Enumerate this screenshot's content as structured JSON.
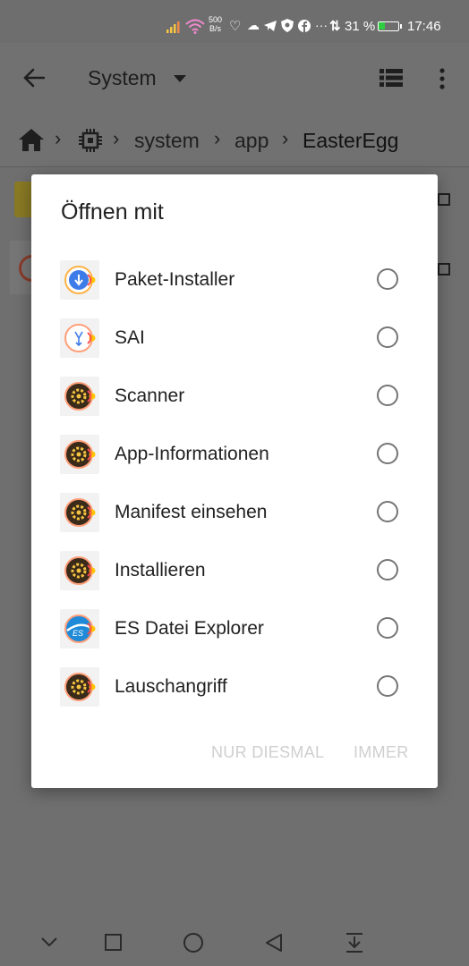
{
  "status_bar": {
    "net_speed_value": "500",
    "net_speed_unit": "B/s",
    "battery": "31 %",
    "time": "17:46"
  },
  "app_bar": {
    "title": "System"
  },
  "breadcrumb": {
    "items": [
      "system",
      "app",
      "EasterEgg"
    ]
  },
  "dialog": {
    "title": "Öffnen mit",
    "options": [
      {
        "label": "Paket-Installer",
        "icon": "package-installer-icon"
      },
      {
        "label": "SAI",
        "icon": "sai-icon"
      },
      {
        "label": "Scanner",
        "icon": "gear-app-icon"
      },
      {
        "label": "App-Informationen",
        "icon": "gear-app-icon"
      },
      {
        "label": "Manifest einsehen",
        "icon": "gear-app-icon"
      },
      {
        "label": "Installieren",
        "icon": "gear-app-icon"
      },
      {
        "label": "ES Datei Explorer",
        "icon": "es-explorer-icon"
      },
      {
        "label": "Lauschangriff",
        "icon": "gear-app-icon"
      }
    ],
    "button_once": "NUR DIESMAL",
    "button_always": "IMMER"
  },
  "colors": {
    "scrim": "#6f6f6f",
    "dialog_bg": "#ffffff",
    "disabled_button": "#cfcfcf"
  }
}
